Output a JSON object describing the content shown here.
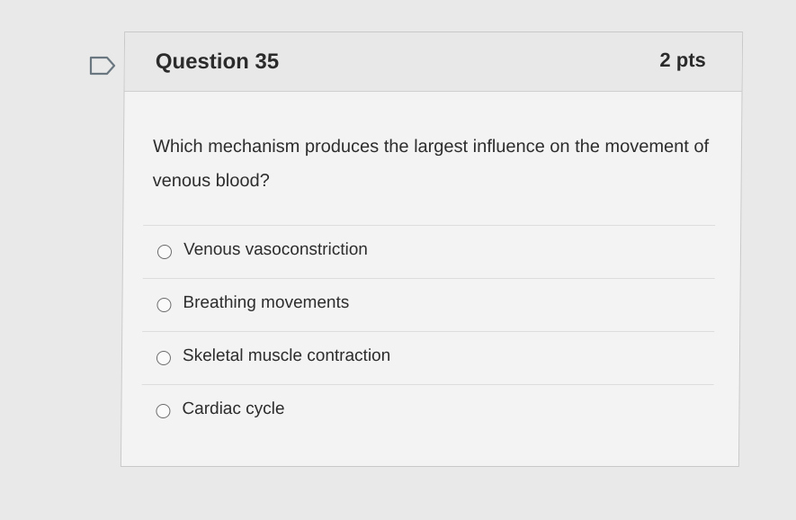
{
  "question": {
    "title": "Question 35",
    "points": "2 pts",
    "text": "Which mechanism produces the largest influence on the movement of venous blood?",
    "flag_icon": "flag-outline-icon"
  },
  "answers": [
    {
      "label": "Venous vasoconstriction",
      "selected": false
    },
    {
      "label": "Breathing movements",
      "selected": false
    },
    {
      "label": "Skeletal muscle contraction",
      "selected": false
    },
    {
      "label": "Cardiac cycle",
      "selected": false
    }
  ],
  "colors": {
    "page_background": "#e9e9e9",
    "card_background": "#f3f3f3",
    "header_background": "#e8e8e8",
    "text": "#2d2d2d"
  }
}
